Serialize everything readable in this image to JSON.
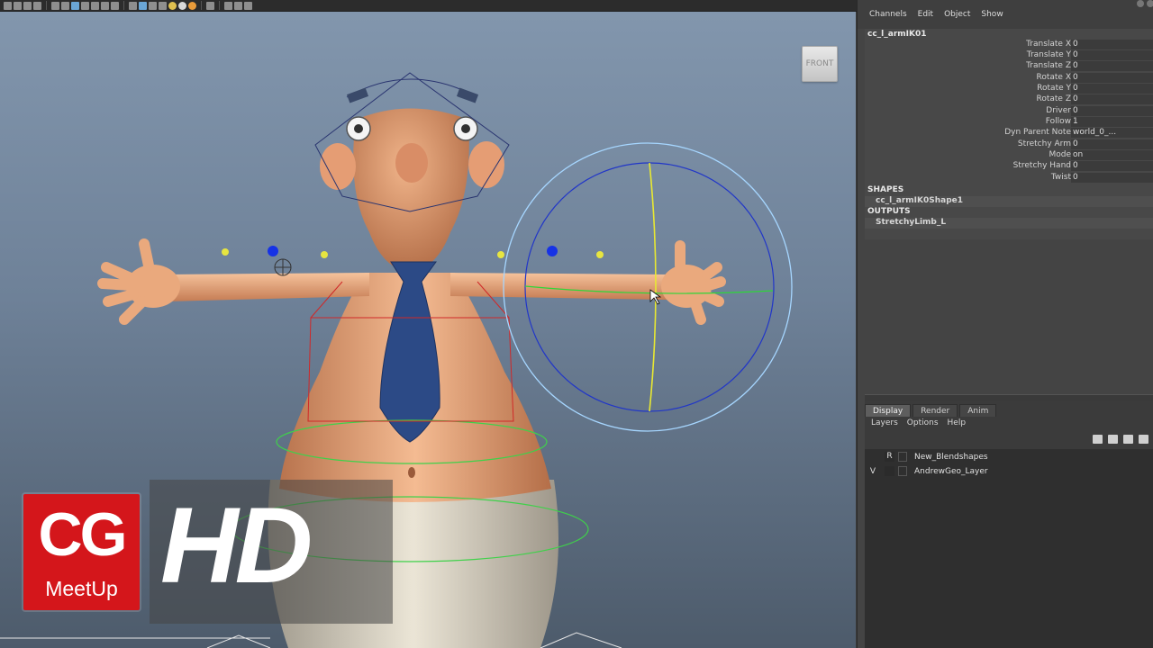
{
  "viewport": {
    "view_cube_label": "FRONT"
  },
  "channel_box": {
    "menu": [
      "Channels",
      "Edit",
      "Object",
      "Show"
    ],
    "node_name": "cc_l_armIK01",
    "attributes": [
      {
        "label": "Translate X",
        "value": "0"
      },
      {
        "label": "Translate Y",
        "value": "0"
      },
      {
        "label": "Translate Z",
        "value": "0"
      },
      {
        "label": "Rotate X",
        "value": "0"
      },
      {
        "label": "Rotate Y",
        "value": "0"
      },
      {
        "label": "Rotate Z",
        "value": "0"
      },
      {
        "label": "Driver",
        "value": "0"
      },
      {
        "label": "Follow",
        "value": "1"
      },
      {
        "label": "Dyn Parent Note",
        "value": "world_0_..."
      },
      {
        "label": "Stretchy Arm",
        "value": "0"
      },
      {
        "label": "Mode",
        "value": "on"
      },
      {
        "label": "Stretchy Hand",
        "value": "0"
      },
      {
        "label": "Twist",
        "value": "0"
      }
    ],
    "shapes_header": "SHAPES",
    "shape_item": "cc_l_armIK0Shape1",
    "outputs_header": "OUTPUTS",
    "output_item": "StretchyLimb_L"
  },
  "layer_editor": {
    "tabs": [
      "Display",
      "Render",
      "Anim"
    ],
    "menu": [
      "Layers",
      "Options",
      "Help"
    ],
    "layers": [
      {
        "vis": "",
        "type": "R",
        "name": "New_Blendshapes"
      },
      {
        "vis": "V",
        "type": "",
        "name": "AndrewGeo_Layer"
      }
    ]
  },
  "watermark": {
    "logo_main": "CG",
    "logo_sub": "MeetUp",
    "badge": "HD"
  },
  "colors": {
    "viewport_top": "#8296ad",
    "viewport_bottom": "#4d5b6b",
    "logo_red": "#d4161b",
    "skin": "#e7a77e",
    "tie": "#2c4a86"
  }
}
